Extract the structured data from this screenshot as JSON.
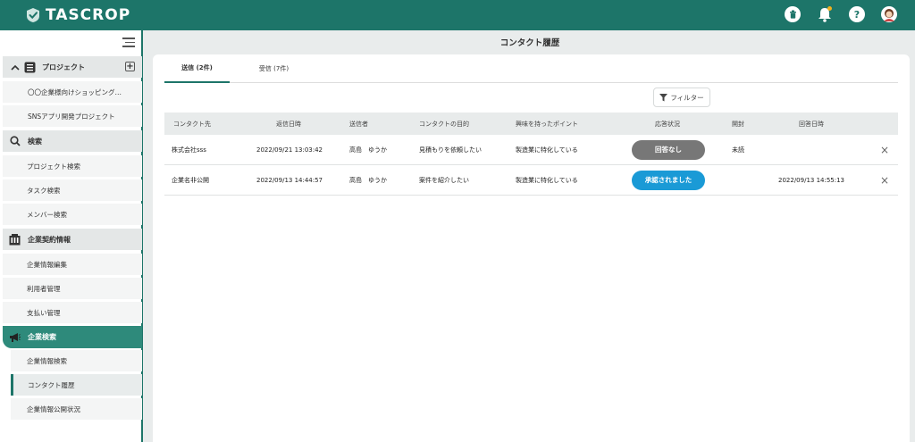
{
  "header": {
    "logo_text": "TASCROP",
    "colors": {
      "brand": "#1d7569",
      "accent": "#2e8a7b",
      "notification_dot": "#f2b01e"
    },
    "icons": [
      "trash-circle-icon",
      "bell-icon",
      "help-icon",
      "user-avatar"
    ]
  },
  "sidebar": {
    "menu_icon": "hamburger-icon",
    "sections": [
      {
        "label": "プロジェクト",
        "icon": "project-icon",
        "items": [
          "〇〇企業様向けショッピング…",
          "SNSアプリ開発プロジェクト"
        ]
      },
      {
        "label": "検索",
        "icon": "search-icon",
        "items": [
          "プロジェクト検索",
          "タスク検索",
          "メンバー検索"
        ]
      },
      {
        "label": "企業契約情報",
        "icon": "building-icon",
        "items": [
          "企業情報編集",
          "利用者管理",
          "支払い管理"
        ]
      },
      {
        "label": "企業検索",
        "icon": "megaphone-icon",
        "items": [
          "企業情報検索",
          "コンタクト履歴",
          "企業情報公開状況"
        ]
      }
    ]
  },
  "main": {
    "title": "コンタクト履歴",
    "tabs": [
      {
        "label": "送信 (2件)"
      },
      {
        "label": "受信 (7件)"
      }
    ],
    "filter_label": "フィルター",
    "table": {
      "headers": [
        "コンタクト先",
        "返信日時",
        "送信者",
        "コンタクトの目的",
        "興味を持ったポイント",
        "応答状況",
        "開封",
        "回答日時"
      ],
      "rows": [
        {
          "contact": "株式会社sss",
          "datetime": "2022/09/21 13:03:42",
          "sender": "高島　ゆうか",
          "purpose": "見積もりを依頼したい",
          "interest": "製造業に特化している",
          "status": "回答なし",
          "status_color": "#777777",
          "opened": "未読",
          "answered": ""
        },
        {
          "contact": "企業名非公開",
          "datetime": "2022/09/13 14:44:57",
          "sender": "高島　ゆうか",
          "purpose": "案件を紹介したい",
          "interest": "製造業に特化している",
          "status": "承認されました",
          "status_color": "#1a9ad6",
          "opened": "",
          "answered": "2022/09/13 14:55:13"
        }
      ]
    }
  }
}
